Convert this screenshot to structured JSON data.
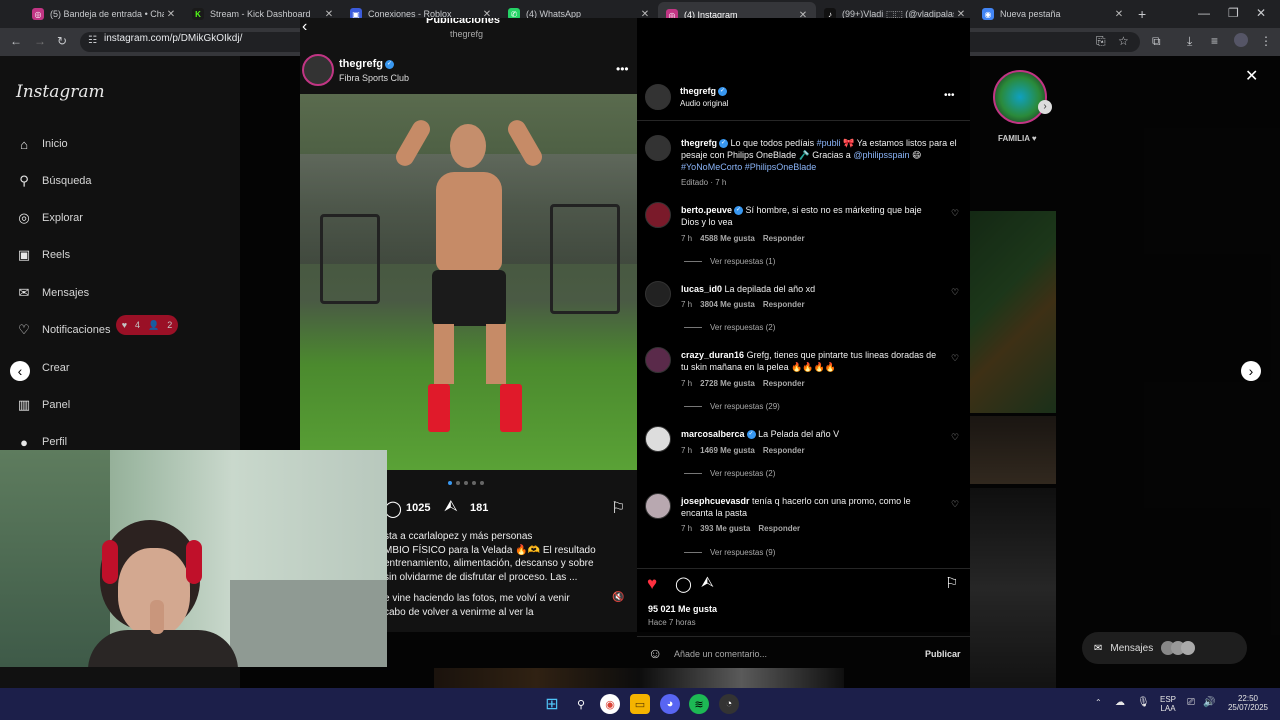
{
  "tabs": [
    {
      "label": "(5) Bandeja de entrada • Chats",
      "color": "#c13584",
      "glyph": "◎"
    },
    {
      "label": "Stream - Kick Dashboard",
      "color": "#53fc18",
      "glyph": "K"
    },
    {
      "label": "Conexiones - Roblox",
      "color": "#3b5bdb",
      "glyph": "▣"
    },
    {
      "label": "(4) WhatsApp",
      "color": "#25d366",
      "glyph": "✆"
    },
    {
      "label": "(4) Instagram",
      "color": "#c13584",
      "glyph": "◎"
    },
    {
      "label": "(99+)Vladi ⬚⬚ (@vladipalas) | T",
      "color": "#111111",
      "glyph": "♪"
    },
    {
      "label": "Nueva pestaña",
      "color": "#4285f4",
      "glyph": "◉"
    }
  ],
  "url": "instagram.com/p/DMikGkOIkdj/",
  "instagram": {
    "logo": "Instagram",
    "nav": [
      {
        "label": "Inicio",
        "icon": "home-icon",
        "glyph": "⌂"
      },
      {
        "label": "Búsqueda",
        "icon": "search-icon",
        "glyph": "⚲"
      },
      {
        "label": "Explorar",
        "icon": "compass-icon",
        "glyph": "◎"
      },
      {
        "label": "Reels",
        "icon": "reels-icon",
        "glyph": "▣"
      },
      {
        "label": "Mensajes",
        "icon": "messenger-icon",
        "glyph": "✉"
      },
      {
        "label": "Notificaciones",
        "icon": "heart-icon",
        "glyph": "♡"
      },
      {
        "label": "Crear",
        "icon": "plus-icon",
        "glyph": "⊕"
      },
      {
        "label": "Panel",
        "icon": "dashboard-icon",
        "glyph": "▥"
      },
      {
        "label": "Perfil",
        "icon": "profile-icon",
        "glyph": "●"
      }
    ],
    "notif_badge": {
      "likes": "4",
      "follows": "2"
    },
    "story_right_label": "FAMILIA ♥",
    "messages_bubble": "Mensajes"
  },
  "post_left": {
    "header_title": "Publicaciones",
    "header_sub": "thegrefg",
    "username": "thegrefg",
    "location": "Fibra Sports Club",
    "comments_count": "1025",
    "shares_count": "181",
    "caption_lines": [
      "sta a ccarlalopez y más personas",
      "MBIO FÍSICO para la Velada 🔥🫶 El resultado",
      "entrenamiento, alimentación, descanso y sobre",
      "sin olvidarme de disfrutar el proceso. Las ...",
      "",
      "e vine haciendo las fotos, me volví a venir",
      "cabo de volver a venirme al ver la"
    ]
  },
  "post_right": {
    "username": "thegrefg",
    "audio": "Audio original",
    "caption": {
      "text1": "Lo que todos pedíais",
      "tag1": "#publi",
      "text2": "🎀 Ya estamos listos para el pesaje con Philips OneBlade 🪒 Gracias a",
      "mention": "@philipsspain",
      "text3": "😄",
      "hashtags": "#YoNoMeCorto #PhilipsOneBlade",
      "meta": "Editado · 7 h"
    },
    "comments": [
      {
        "user": "berto.peuve",
        "verified": true,
        "text": "Sí hombre, si esto no es márketing que baje Dios y lo vea",
        "time": "7 h",
        "likes": "4588 Me gusta",
        "reply": "Responder",
        "replies": "Ver respuestas (1)"
      },
      {
        "user": "lucas_id0",
        "verified": false,
        "text": "La depilada del año xd",
        "time": "7 h",
        "likes": "3804 Me gusta",
        "reply": "Responder",
        "replies": "Ver respuestas (2)"
      },
      {
        "user": "crazy_duran16",
        "verified": false,
        "text": "Grefg, tienes que pintarte tus lineas doradas de tu skin mañana en la pelea 🔥🔥🔥🔥",
        "time": "7 h",
        "likes": "2728 Me gusta",
        "reply": "Responder",
        "replies": "Ver respuestas (29)"
      },
      {
        "user": "marcosalberca",
        "verified": true,
        "text": "La Pelada del año V",
        "time": "7 h",
        "likes": "1469 Me gusta",
        "reply": "Responder",
        "replies": "Ver respuestas (2)"
      },
      {
        "user": "josephcuevasdr",
        "verified": false,
        "text": "tenía q hacerlo con una promo, como le encanta la pasta",
        "time": "7 h",
        "likes": "393 Me gusta",
        "reply": "Responder",
        "replies": "Ver respuestas (9)"
      }
    ],
    "likes": "95 021 Me gusta",
    "time_ago": "Hace 7 horas",
    "comment_placeholder": "Añade un comentario...",
    "publish": "Publicar"
  },
  "taskbar": {
    "lang1": "ESP",
    "lang2": "LAA",
    "time": "22:50",
    "date": "25/07/2025"
  }
}
